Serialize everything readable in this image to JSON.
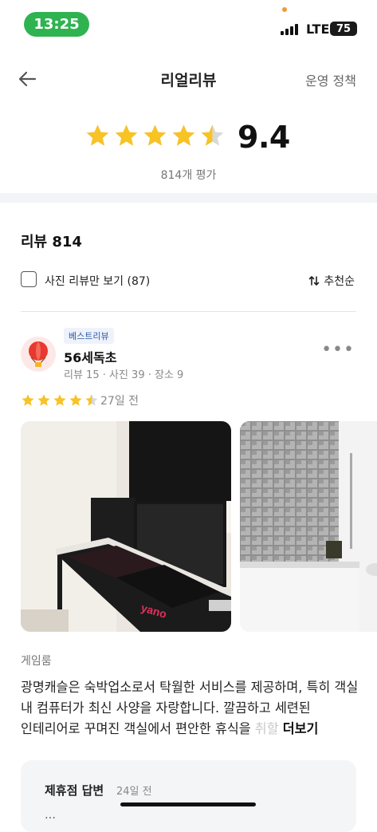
{
  "status_bar": {
    "time": "13:25",
    "network": "LTE",
    "battery": "75"
  },
  "nav": {
    "title": "리얼리뷰",
    "policy_link": "운영 정책",
    "back_icon": "arrow-left-icon"
  },
  "rating": {
    "score": "9.4",
    "stars": 4.5,
    "review_count_text": "814개 평가",
    "star_color": "#f7c325"
  },
  "reviews": {
    "header": "리뷰 814",
    "photo_filter_label": "사진 리뷰만 보기 (87)",
    "photo_filter_checked": false,
    "sort_label": "추천순"
  },
  "review": {
    "badge": "베스트리뷰",
    "name": "56세독초",
    "stats": "리뷰 15 · 사진 39 · 장소 9",
    "stars": 4.5,
    "date": "27일 전",
    "room_type": "게임룸",
    "text_main": "광명캐슬은 숙박업소로서 탁월한 서비스를 제공하며, 특히 객실 내 컴퓨터가 최신 사양을 자랑합니다. 깔끔하고 세련된 인테리어로 꾸며진 객실에서 편안한 휴식을 ",
    "text_faded": "취할",
    "more_label": "더보기",
    "photos": [
      "gaming-desk-photo",
      "bathroom-photo"
    ]
  },
  "reply": {
    "title": "제휴점 답변",
    "date": "24일 전",
    "partial_text": "…"
  }
}
